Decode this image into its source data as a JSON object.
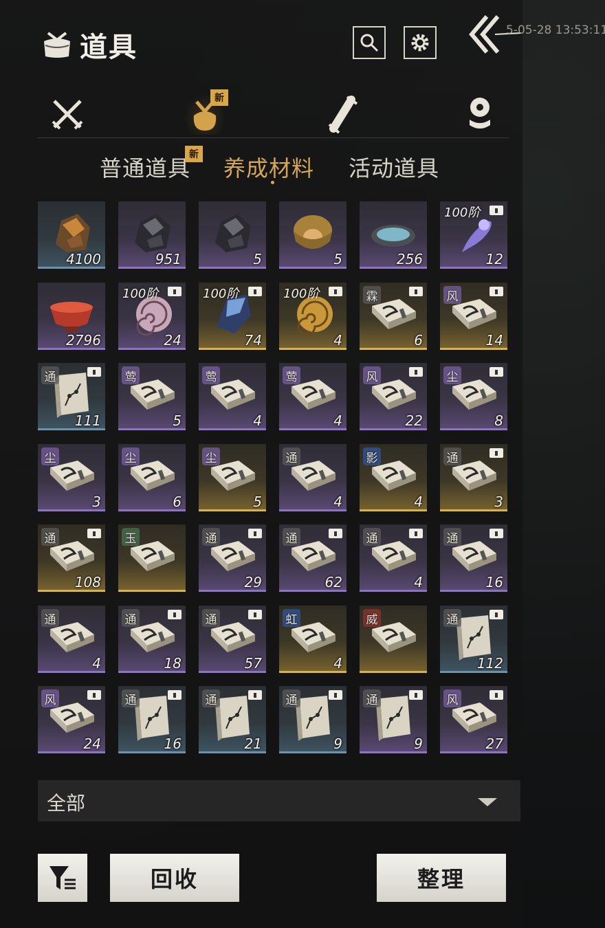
{
  "header": {
    "title": "道具",
    "datetime": "5-05-28 13:53:11",
    "icons": [
      "bag-icon",
      "search-icon",
      "gear-icon",
      "back-arrow-icon"
    ]
  },
  "categories": [
    {
      "icon": "crossed-swords-icon",
      "active": false,
      "new": false
    },
    {
      "icon": "pouch-icon",
      "active": true,
      "new": true
    },
    {
      "icon": "scroll-icon",
      "active": false,
      "new": false
    },
    {
      "icon": "token-icon",
      "active": false,
      "new": false
    }
  ],
  "new_badge": "新",
  "subtabs": [
    {
      "label": "普通道具",
      "active": false,
      "new": true
    },
    {
      "label": "养成材料",
      "active": true,
      "new": false
    },
    {
      "label": "活动道具",
      "active": false,
      "new": false
    }
  ],
  "items": [
    {
      "kind": "ore-gold",
      "rarity": "blue",
      "count": "4100"
    },
    {
      "kind": "ore-dark",
      "rarity": "purple",
      "count": "951"
    },
    {
      "kind": "ore-dark",
      "rarity": "purple",
      "count": "5"
    },
    {
      "kind": "orb",
      "rarity": "purple",
      "count": "5"
    },
    {
      "kind": "pool",
      "rarity": "purple",
      "count": "256"
    },
    {
      "kind": "spirit",
      "rarity": "purple",
      "count": "12",
      "tier": "100阶",
      "lock": true
    },
    {
      "kind": "bowl",
      "rarity": "purple",
      "count": "2796"
    },
    {
      "kind": "shell",
      "rarity": "purple",
      "count": "24",
      "tier": "100阶",
      "lock": true
    },
    {
      "kind": "crystal",
      "rarity": "gold",
      "count": "74",
      "tier": "100阶",
      "lock": true
    },
    {
      "kind": "shell-gold",
      "rarity": "gold",
      "count": "4",
      "tier": "100阶",
      "lock": true
    },
    {
      "kind": "book",
      "rarity": "gold",
      "count": "6",
      "tag": "霖",
      "tagc": "t-tong",
      "lock": true
    },
    {
      "kind": "book",
      "rarity": "gold",
      "count": "14",
      "tag": "风",
      "tagc": "t-purple",
      "lock": true
    },
    {
      "kind": "book-map",
      "rarity": "blue",
      "count": "111",
      "tag": "通",
      "tagc": "t-tong",
      "lock": true
    },
    {
      "kind": "book",
      "rarity": "purple",
      "count": "5",
      "tag": "莺",
      "tagc": "t-purple",
      "lock": false
    },
    {
      "kind": "book",
      "rarity": "purple",
      "count": "4",
      "tag": "莺",
      "tagc": "t-purple",
      "lock": false
    },
    {
      "kind": "book",
      "rarity": "purple",
      "count": "4",
      "tag": "莺",
      "tagc": "t-purple",
      "lock": false
    },
    {
      "kind": "book",
      "rarity": "purple",
      "count": "22",
      "tag": "风",
      "tagc": "t-purple",
      "lock": true
    },
    {
      "kind": "book",
      "rarity": "purple",
      "count": "8",
      "tag": "尘",
      "tagc": "t-purple",
      "lock": true
    },
    {
      "kind": "book",
      "rarity": "purple",
      "count": "3",
      "tag": "尘",
      "tagc": "t-purple",
      "lock": false
    },
    {
      "kind": "book",
      "rarity": "purple",
      "count": "6",
      "tag": "尘",
      "tagc": "t-purple",
      "lock": false
    },
    {
      "kind": "book",
      "rarity": "gold",
      "count": "5",
      "tag": "尘",
      "tagc": "t-purple",
      "lock": false
    },
    {
      "kind": "book",
      "rarity": "purple",
      "count": "4",
      "tag": "通",
      "tagc": "t-tong",
      "lock": false
    },
    {
      "kind": "book",
      "rarity": "gold",
      "count": "4",
      "tag": "影",
      "tagc": "t-blue",
      "lock": false
    },
    {
      "kind": "book",
      "rarity": "gold",
      "count": "3",
      "tag": "通",
      "tagc": "t-tong",
      "lock": true
    },
    {
      "kind": "book",
      "rarity": "gold",
      "count": "108",
      "tag": "通",
      "tagc": "t-tong",
      "lock": true
    },
    {
      "kind": "book",
      "rarity": "gold",
      "count": "",
      "tag": "玉",
      "tagc": "t-green",
      "lock": false
    },
    {
      "kind": "book",
      "rarity": "purple",
      "count": "29",
      "tag": "通",
      "tagc": "t-tong",
      "lock": true
    },
    {
      "kind": "book",
      "rarity": "purple",
      "count": "62",
      "tag": "通",
      "tagc": "t-tong",
      "lock": true
    },
    {
      "kind": "book",
      "rarity": "purple",
      "count": "4",
      "tag": "通",
      "tagc": "t-tong",
      "lock": true
    },
    {
      "kind": "book",
      "rarity": "purple",
      "count": "16",
      "tag": "通",
      "tagc": "t-tong",
      "lock": true
    },
    {
      "kind": "book",
      "rarity": "purple",
      "count": "4",
      "tag": "通",
      "tagc": "t-tong",
      "lock": false
    },
    {
      "kind": "book",
      "rarity": "purple",
      "count": "18",
      "tag": "通",
      "tagc": "t-tong",
      "lock": true
    },
    {
      "kind": "book",
      "rarity": "purple",
      "count": "57",
      "tag": "通",
      "tagc": "t-tong",
      "lock": true
    },
    {
      "kind": "book",
      "rarity": "gold",
      "count": "4",
      "tag": "虹",
      "tagc": "t-blue",
      "lock": false
    },
    {
      "kind": "book",
      "rarity": "gold",
      "count": "",
      "tag": "威",
      "tagc": "t-red",
      "lock": false
    },
    {
      "kind": "book-map",
      "rarity": "blue",
      "count": "112",
      "tag": "通",
      "tagc": "t-tong",
      "lock": true
    },
    {
      "kind": "book",
      "rarity": "purple",
      "count": "24",
      "tag": "风",
      "tagc": "t-purple",
      "lock": true
    },
    {
      "kind": "book-map",
      "rarity": "blue",
      "count": "16",
      "tag": "通",
      "tagc": "t-tong",
      "lock": true
    },
    {
      "kind": "book-map",
      "rarity": "blue",
      "count": "21",
      "tag": "通",
      "tagc": "t-tong",
      "lock": true
    },
    {
      "kind": "book-map",
      "rarity": "blue",
      "count": "9",
      "tag": "通",
      "tagc": "t-tong",
      "lock": true
    },
    {
      "kind": "book-map",
      "rarity": "purple",
      "count": "9",
      "tag": "通",
      "tagc": "t-tong",
      "lock": true
    },
    {
      "kind": "book",
      "rarity": "purple",
      "count": "27",
      "tag": "风",
      "tagc": "t-purple",
      "lock": true
    }
  ],
  "filter": {
    "label": "全部"
  },
  "buttons": {
    "recycle": "回收",
    "sort": "整理"
  },
  "colors": {
    "accent": "#d4a65a",
    "purple_rarity": "#8d74c2",
    "gold_rarity": "#d8b24c",
    "blue_rarity": "#6d92b0",
    "badge": "#d9a64a"
  }
}
